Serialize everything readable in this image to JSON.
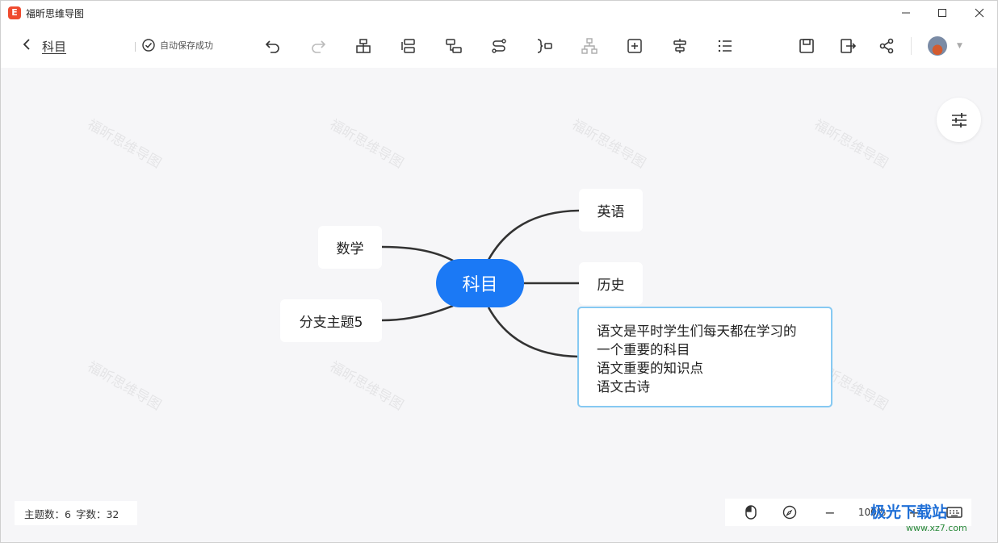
{
  "window": {
    "app_title": "福昕思维导图",
    "logo_letter": "E"
  },
  "toolbar": {
    "doc_title": "科目",
    "save_status": "自动保存成功"
  },
  "mindmap": {
    "root": "科目",
    "left_nodes": [
      "数学",
      "分支主题5"
    ],
    "right_nodes": [
      "英语",
      "历史"
    ],
    "note_lines": [
      "语文是平时学生们每天都在学习的",
      "一个重要的科目",
      "语文重要的知识点",
      "语文古诗"
    ],
    "watermark_text": "福昕思维导图"
  },
  "stats": {
    "topics": "主题数：6",
    "chars": "字数：32"
  },
  "zoom": {
    "level": "100%"
  },
  "site_watermark": {
    "main": "极光下载站",
    "sub": "www.xz7.com"
  },
  "colors": {
    "root": "#1b79f5",
    "note_border": "#86c9f2",
    "logo": "#ef4b2f"
  }
}
